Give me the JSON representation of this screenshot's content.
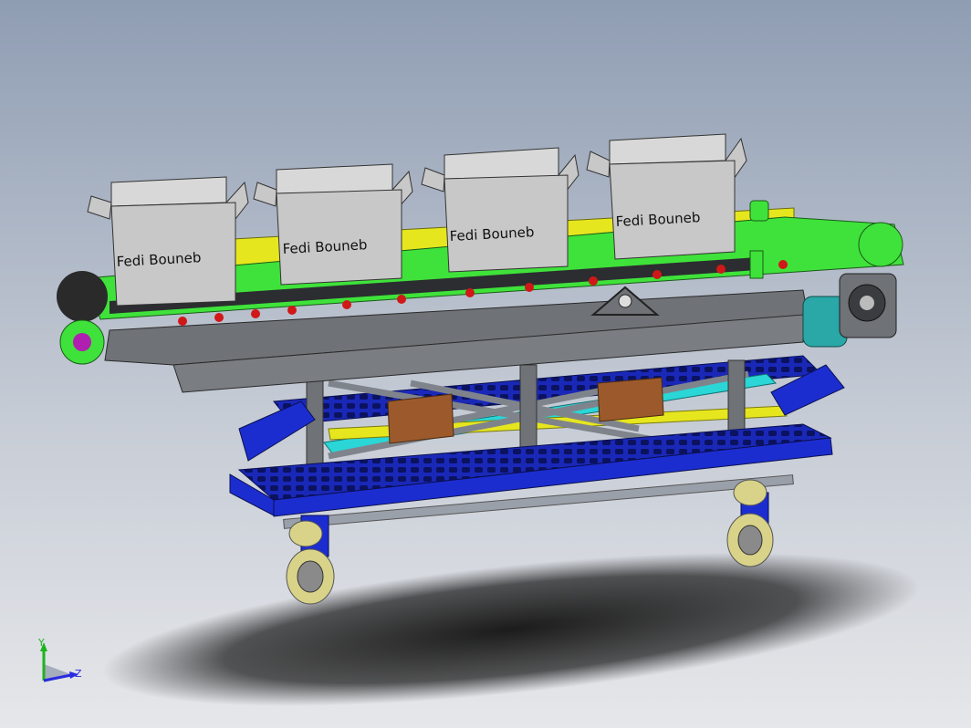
{
  "scene": {
    "background_top": "#8f9db3",
    "background_bottom": "#e4e6ea",
    "box_label": "Fedi Bouneb",
    "box_labels": [
      "Fedi Bouneb",
      "Fedi Bouneb",
      "Fedi Bouneb",
      "Fedi Bouneb"
    ]
  },
  "triad": {
    "y_label": "Y",
    "z_label": "Z",
    "y_color": "#1db31d",
    "z_color": "#2a2ae0"
  },
  "colors": {
    "belt_green": "#3fe23a",
    "belt_yellow": "#e6e61e",
    "frame_gray": "#6f7276",
    "box_gray": "#c8c8c8",
    "scissor_gray": "#9a9ea6",
    "platform_blue": "#1c2dd0",
    "cyan": "#2ad6d6",
    "brown": "#9c5a2c",
    "wheel_yellow": "#d9d38a",
    "motor_teal": "#2aa7a7"
  }
}
